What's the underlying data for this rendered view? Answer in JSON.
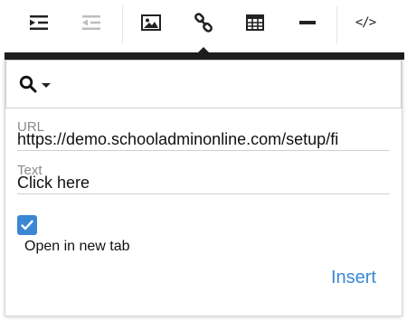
{
  "toolbar": {
    "buttons": [
      {
        "name": "indent",
        "icon": "indent-icon",
        "disabled": false
      },
      {
        "name": "outdent",
        "icon": "outdent-icon",
        "disabled": true
      },
      {
        "name": "image",
        "icon": "image-icon",
        "disabled": false
      },
      {
        "name": "link",
        "icon": "link-icon",
        "disabled": false
      },
      {
        "name": "table",
        "icon": "table-icon",
        "disabled": false
      },
      {
        "name": "horizontal-rule",
        "icon": "horizontal-rule-icon",
        "disabled": false
      },
      {
        "name": "code-view",
        "icon": "code-icon",
        "disabled": false
      }
    ],
    "code_label": "</>"
  },
  "link_popover": {
    "search_icon": "search-icon",
    "url": {
      "label": "URL",
      "value": "https://demo.schooladminonline.com/setup/fi"
    },
    "text": {
      "label": "Text",
      "value": "Click here"
    },
    "open_in_new_tab": {
      "label": "Open in new tab",
      "checked": true
    },
    "insert_label": "Insert"
  },
  "colors": {
    "accent": "#3a87d4",
    "popover_bar": "#1d1d1d",
    "disabled_icon": "#bdbdbd"
  }
}
